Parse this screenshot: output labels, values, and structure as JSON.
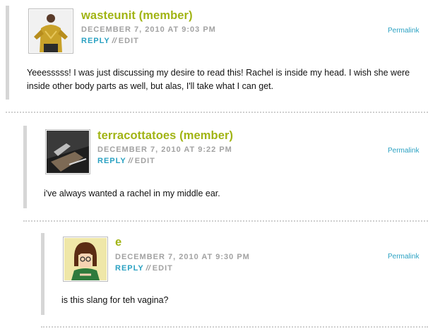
{
  "comments": [
    {
      "author": "wasteunit (member)",
      "date": "DECEMBER 7, 2010 AT 9:03 PM",
      "reply_label": "REPLY",
      "separator": "//",
      "edit_label": "EDIT",
      "permalink_label": "Permalink",
      "text_lines": [
        "Yeeesssss! I was just discussing my desire to read this! Rachel is inside my head. I wish she were",
        "inside other body parts as well, but alas, I'll take what I can get."
      ]
    },
    {
      "author": "terracottatoes (member)",
      "date": "DECEMBER 7, 2010 AT 9:22 PM",
      "reply_label": "REPLY",
      "separator": "//",
      "edit_label": "EDIT",
      "permalink_label": "Permalink",
      "text_lines": [
        "i've always wanted a rachel in my middle ear."
      ]
    },
    {
      "author": "e",
      "date": "DECEMBER 7, 2010 AT 9:30 PM",
      "reply_label": "REPLY",
      "separator": "//",
      "edit_label": "EDIT",
      "permalink_label": "Permalink",
      "text_lines": [
        "is this slang for teh vagina?"
      ]
    }
  ],
  "colors": {
    "author": "#a1b414",
    "meta": "#a2a2a2",
    "link": "#2aa1c2",
    "thread_bar": "#d6d6d6"
  }
}
